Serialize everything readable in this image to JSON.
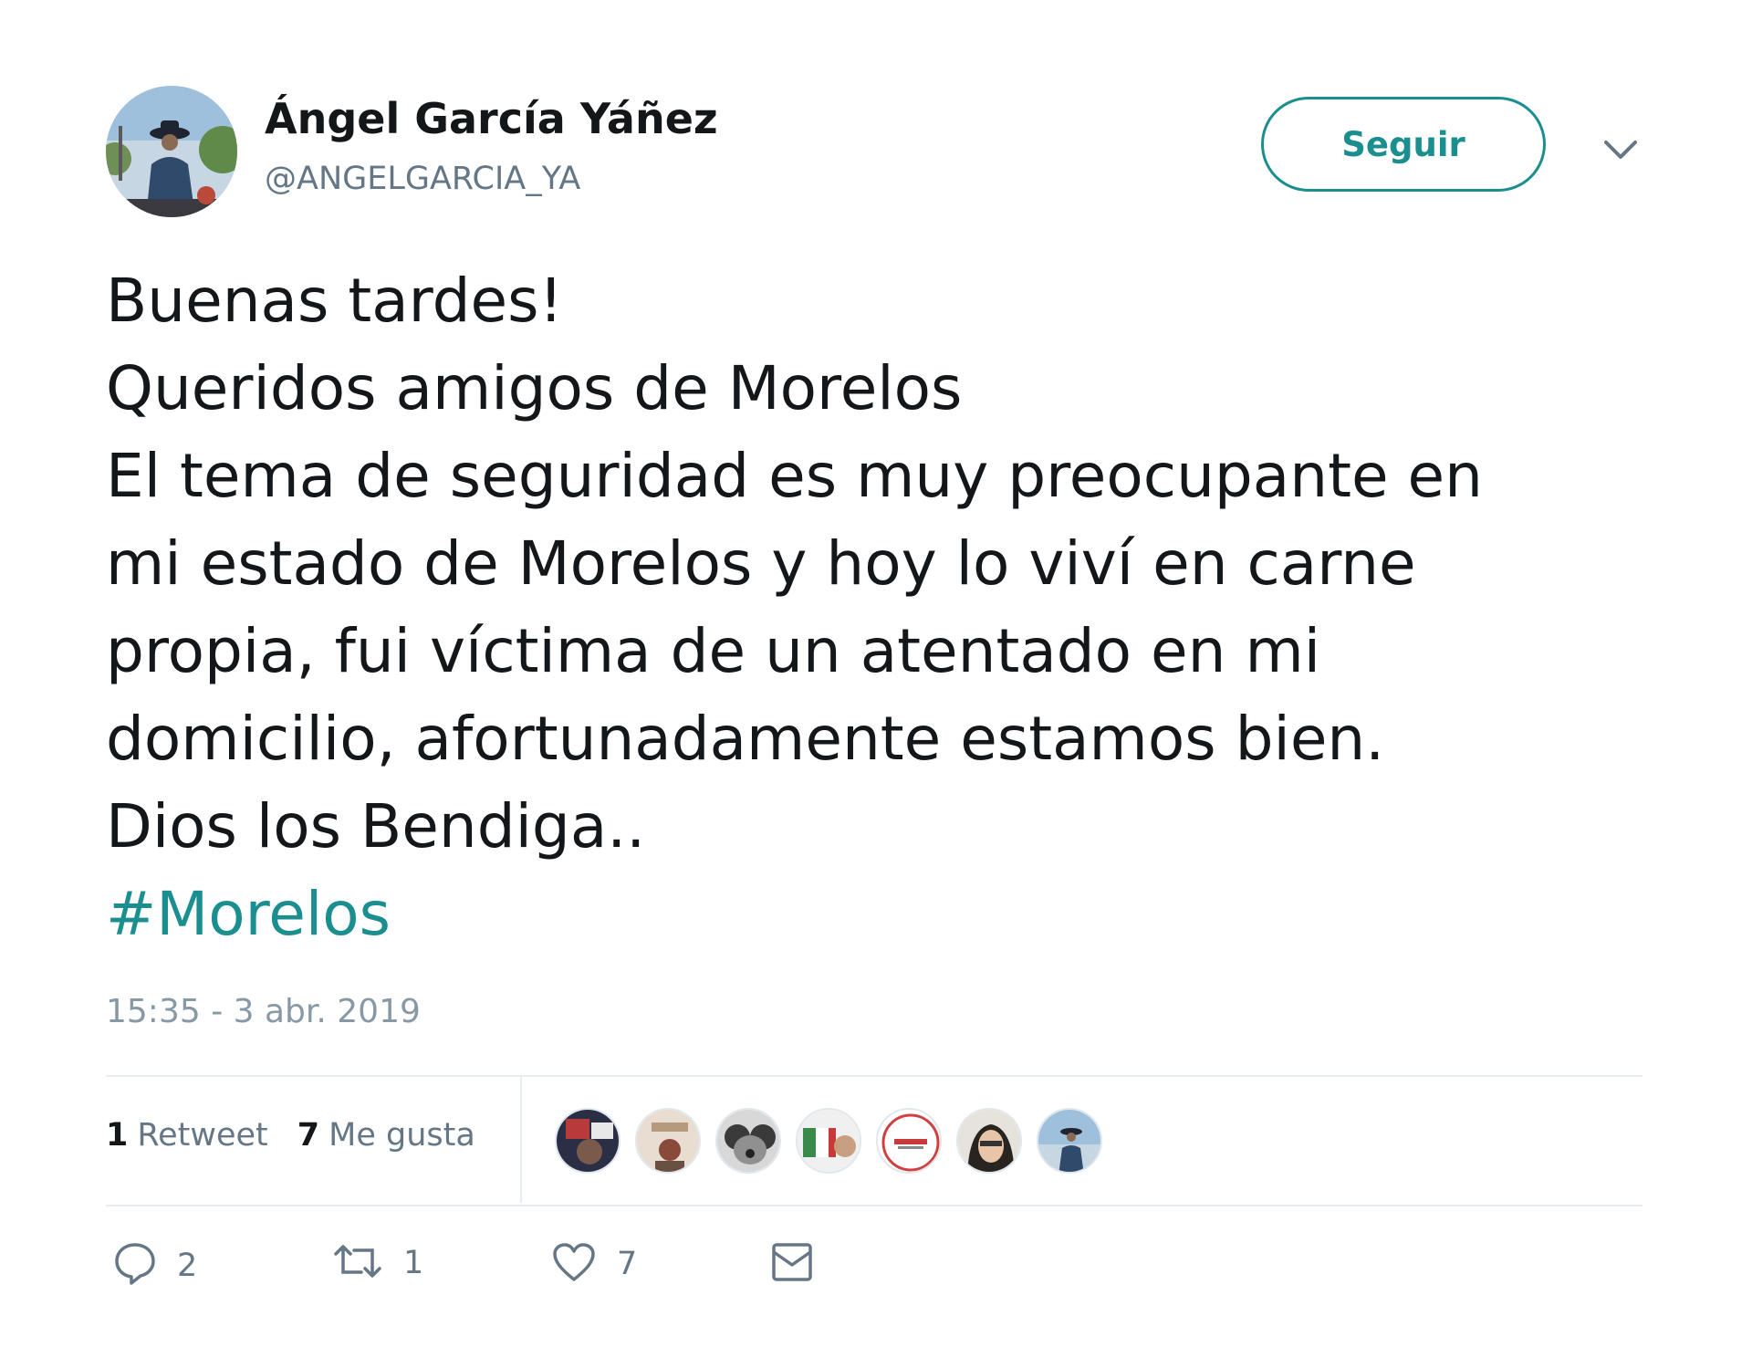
{
  "author": {
    "name": "Ángel García Yáñez",
    "handle": "@ANGELGARCIA_YA",
    "avatar_icon": "profile-photo"
  },
  "header": {
    "follow_label": "Seguir",
    "menu_icon": "chevron-down-icon"
  },
  "tweet": {
    "lines": [
      "Buenas tardes!",
      "Queridos amigos de Morelos",
      "El tema de seguridad es muy preocupante en",
      "mi estado de Morelos y hoy lo viví en carne",
      "propia, fui víctima de un atentado en mi",
      "domicilio, afortunadamente estamos bien.",
      "Dios los Bendiga.."
    ],
    "hashtag": "#Morelos",
    "timestamp": "15:35 - 3 abr. 2019"
  },
  "stats": {
    "retweets_count": "1",
    "retweets_label": "Retweet",
    "likes_count": "7",
    "likes_label": "Me gusta"
  },
  "actions": {
    "reply_count": "2",
    "retweet_count": "1",
    "like_count": "7"
  },
  "colors": {
    "accent": "#1b8f8f",
    "text": "#14171a",
    "muted": "#657786",
    "border": "#e6ecf0"
  }
}
